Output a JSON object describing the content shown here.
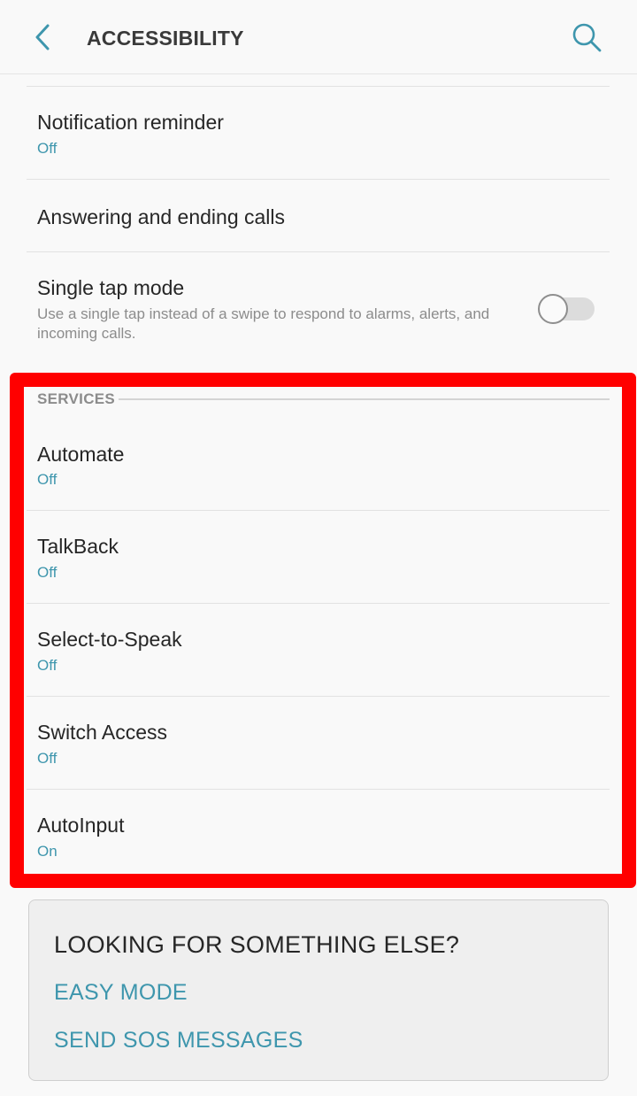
{
  "header": {
    "title": "ACCESSIBILITY",
    "back_icon": "chevron-left-icon",
    "search_icon": "search-icon",
    "accent": "#3e96ad"
  },
  "items_top": [
    {
      "title": "Notification reminder",
      "status": "Off"
    },
    {
      "title": "Answering and ending calls"
    },
    {
      "title": "Single tap mode",
      "description": "Use a single tap instead of a swipe to respond to alarms, alerts, and incoming calls.",
      "toggle_on": false
    }
  ],
  "services": {
    "header": "SERVICES",
    "items": [
      {
        "title": "Automate",
        "status": "Off"
      },
      {
        "title": "TalkBack",
        "status": "Off"
      },
      {
        "title": "Select-to-Speak",
        "status": "Off"
      },
      {
        "title": "Switch Access",
        "status": "Off"
      },
      {
        "title": "AutoInput",
        "status": "On"
      }
    ],
    "highlight_color": "#ff0000"
  },
  "suggestions": {
    "title": "LOOKING FOR SOMETHING ELSE?",
    "links": [
      "EASY MODE",
      "SEND SOS MESSAGES"
    ]
  }
}
